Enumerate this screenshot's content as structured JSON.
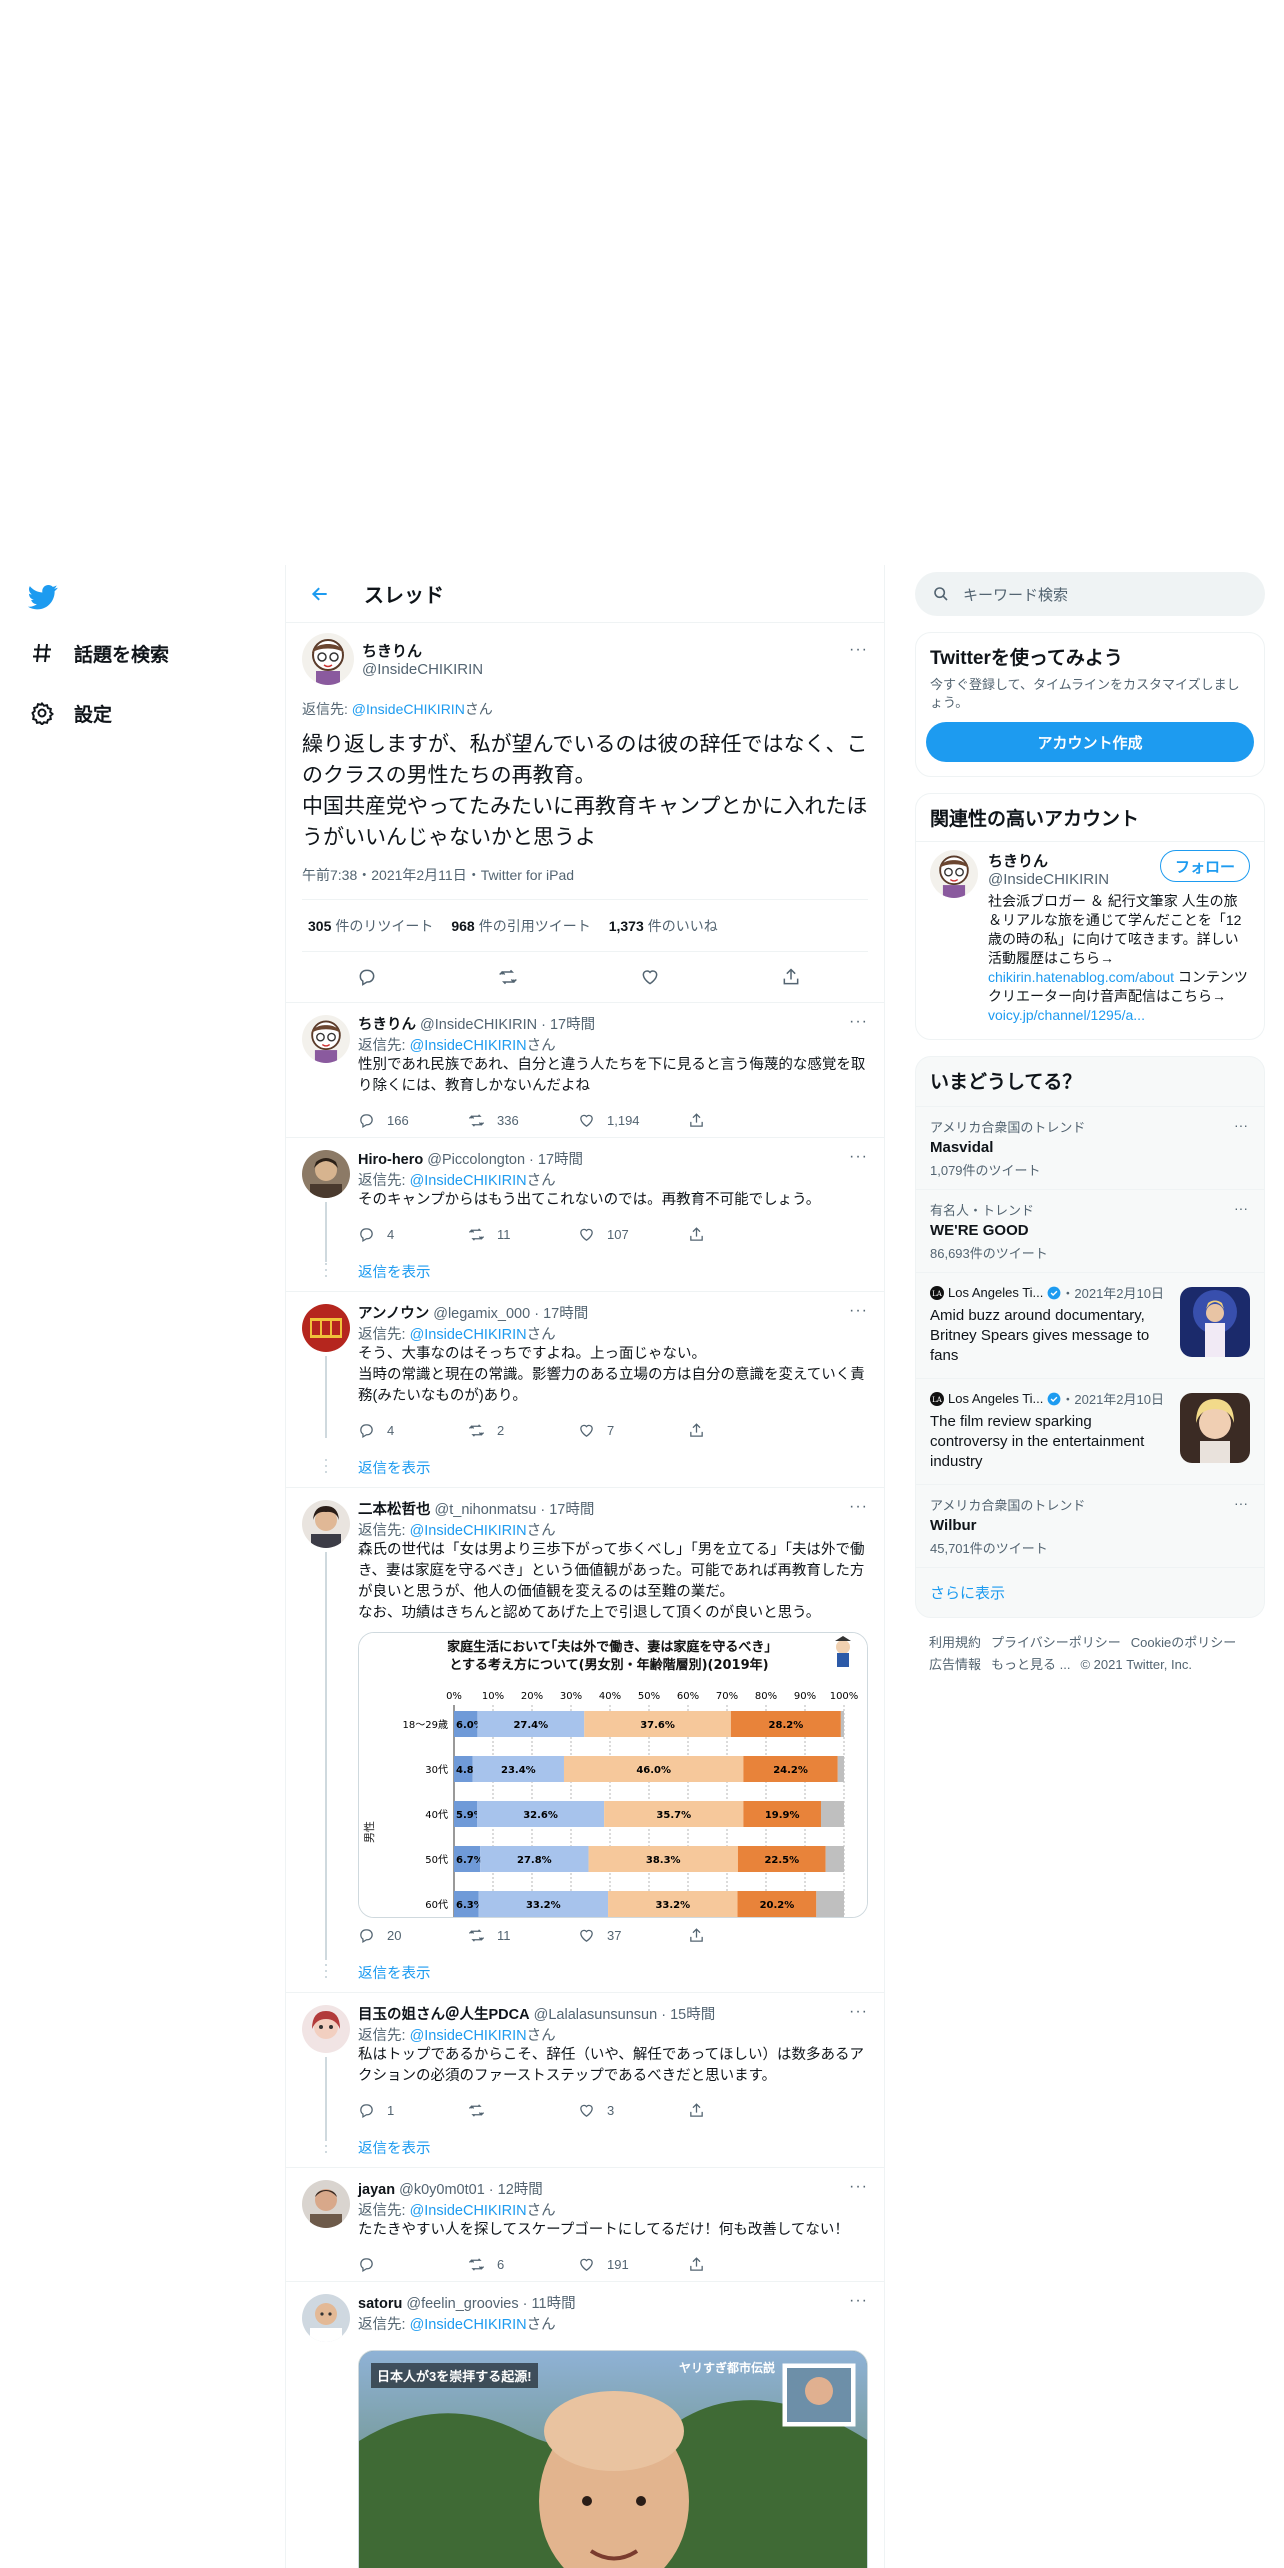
{
  "nav": {
    "explore": "話題を検索",
    "settings": "設定"
  },
  "header": {
    "title": "スレッド"
  },
  "focus": {
    "name": "ちきりん",
    "handle": "@InsideCHIKIRIN",
    "reply_prefix": "返信先: ",
    "reply_mention": "@InsideCHIKIRIN",
    "reply_suffix": "さん",
    "text": "繰り返しますが、私が望んでいるのは彼の辞任ではなく、このクラスの男性たちの再教育。\n中国共産党やってたみたいに再教育キャンプとかに入れたほうがいいんじゃないかと思うよ",
    "meta": "午前7:38・2021年2月11日・Twitter for iPad",
    "retweets_num": "305",
    "retweets_label": "件のリツイート",
    "quotes_num": "968",
    "quotes_label": "件の引用ツイート",
    "likes_num": "1,373",
    "likes_label": "件のいいね"
  },
  "replies": [
    {
      "name": "ちきりん",
      "handle": "@InsideCHIKIRIN",
      "time": "17時間",
      "reply_prefix": "返信先: ",
      "mention": "@InsideCHIKIRIN",
      "suffix": "さん",
      "text": "性別であれ民族であれ、自分と違う人たちを下に見ると言う侮蔑的な感覚を取り除くには、教育しかないんだよね",
      "replies": "166",
      "retweets": "336",
      "likes": "1,194"
    },
    {
      "name": "Hiro-hero",
      "handle": "@Piccolongton",
      "time": "17時間",
      "reply_prefix": "返信先: ",
      "mention": "@InsideCHIKIRIN",
      "suffix": "さん",
      "text": "そのキャンプからはもう出てこれないのでは。再教育不可能でしょう。",
      "replies": "4",
      "retweets": "11",
      "likes": "107",
      "show_more": "返信を表示"
    },
    {
      "name": "アンノウン",
      "handle": "@legamix_000",
      "time": "17時間",
      "reply_prefix": "返信先: ",
      "mention": "@InsideCHIKIRIN",
      "suffix": "さん",
      "text": "そう、大事なのはそっちですよね。上っ面じゃない。\n当時の常識と現在の常識。影響力のある立場の方は自分の意識を変えていく責務(みたいなものが)あり。",
      "replies": "4",
      "retweets": "2",
      "likes": "7",
      "show_more": "返信を表示"
    },
    {
      "name": "二本松哲也",
      "handle": "@t_nihonmatsu",
      "time": "17時間",
      "reply_prefix": "返信先: ",
      "mention": "@InsideCHIKIRIN",
      "suffix": "さん",
      "text": "森氏の世代は「女は男より三歩下がって歩くべし」「男を立てる」「夫は外で働き、妻は家庭を守るべき」という価値観があった。可能であれば再教育した方が良いと思うが、他人の価値観を変えるのは至難の業だ。\nなお、功績はきちんと認めてあげた上で引退して頂くのが良いと思う。",
      "replies": "20",
      "retweets": "11",
      "likes": "37",
      "show_more": "返信を表示"
    },
    {
      "name": "目玉の姐さん＠人生PDCA",
      "handle": "@Lalalasunsunsun",
      "time": "15時間",
      "reply_prefix": "返信先: ",
      "mention": "@InsideCHIKIRIN",
      "suffix": "さん",
      "text": "私はトップであるからこそ、辞任（いや、解任であってほしい）は数多あるアクションの必須のファーストステップであるべきだと思います。",
      "replies": "1",
      "retweets": "",
      "likes": "3",
      "show_more": "返信を表示"
    },
    {
      "name": "jayan",
      "handle": "@k0y0m0t01",
      "time": "12時間",
      "reply_prefix": "返信先: ",
      "mention": "@InsideCHIKIRIN",
      "suffix": "さん",
      "text": "たたきやすい人を探してスケープゴートにしてるだけ！何も改善してない！",
      "replies": "",
      "retweets": "6",
      "likes": "191"
    },
    {
      "name": "satoru",
      "handle": "@feelin_groovies",
      "time": "11時間",
      "reply_prefix": "返信先: ",
      "mention": "@InsideCHIKIRIN",
      "suffix": "さん",
      "video_caption_left": "日本人が3を崇拝する起源!",
      "video_caption_right": "ヤリすぎ都市伝説"
    }
  ],
  "chart_data": {
    "type": "bar",
    "title": "家庭生活において｢夫は外で働き、妻は家庭を守るべき｣\nとする考え方について(男女別・年齢階層別)(2019年)",
    "x_ticks": [
      "0%",
      "10%",
      "20%",
      "30%",
      "40%",
      "50%",
      "60%",
      "70%",
      "80%",
      "90%",
      "100%"
    ],
    "group_label": "男性",
    "categories": [
      "18～29歳",
      "30代",
      "40代",
      "50代",
      "60代"
    ],
    "series": [
      {
        "values": [
          6.0,
          4.8,
          5.9,
          6.7,
          6.3
        ]
      },
      {
        "values": [
          27.4,
          23.4,
          32.6,
          27.8,
          33.2
        ]
      },
      {
        "values": [
          37.6,
          46.0,
          35.7,
          38.3,
          33.2
        ]
      },
      {
        "values": [
          28.2,
          24.2,
          19.9,
          22.5,
          20.2
        ]
      },
      {
        "values": [
          0.8,
          1.6,
          5.9,
          4.7,
          7.1
        ]
      }
    ],
    "colors": [
      "#6f9ad8",
      "#a7c3ec",
      "#f6c89b",
      "#e8833a",
      "#bfbfbf"
    ],
    "labeled_series": [
      0,
      1,
      2,
      3
    ]
  },
  "sidebar": {
    "search_placeholder": "キーワード検索",
    "signup": {
      "title": "Twitterを使ってみよう",
      "sub": "今すぐ登録して、タイムラインをカスタマイズしましょう。",
      "button": "アカウント作成"
    },
    "related": {
      "title": "関連性の高いアカウント",
      "name": "ちきりん",
      "handle": "@InsideCHIKIRIN",
      "follow": "フォロー",
      "bio_1": "社会派ブロガー ＆ 紀行文筆家 人生の旅＆リアルな旅を通じて学んだことを「12歳の時の私」に向けて呟きます。詳しい活動履歴はこちら→ ",
      "bio_link1": "chikirin.hatenablog.com/about",
      "bio_2": " コンテンツクリエーター向け音声配信はこちら→ ",
      "bio_link2": "voicy.jp/channel/1295/a..."
    },
    "trends": {
      "title": "いまどうしてる？",
      "t1_ctx": "アメリカ合衆国のトレンド",
      "t1_name": "Masvidal",
      "t1_count": "1,079件のツイート",
      "t2_ctx": "有名人・トレンド",
      "t2_name": "WE'RE GOOD",
      "t2_count": "86,693件のツイート",
      "n1_src": "Los Angeles Ti...",
      "n1_date": "・2021年2月10日",
      "n1_headline": "Amid buzz around documentary, Britney Spears gives message to fans",
      "n2_src": "Los Angeles Ti...",
      "n2_date": "・2021年2月10日",
      "n2_headline": "The film review sparking controversy in the entertainment industry",
      "t3_ctx": "アメリカ合衆国のトレンド",
      "t3_name": "Wilbur",
      "t3_count": "45,701件のツイート",
      "more": "さらに表示"
    },
    "footer": {
      "terms": "利用規約",
      "privacy": "プライバシーポリシー",
      "cookie": "Cookieのポリシー",
      "ads": "広告情報",
      "more": "もっと見る ...",
      "copyright": "© 2021 Twitter, Inc."
    }
  }
}
